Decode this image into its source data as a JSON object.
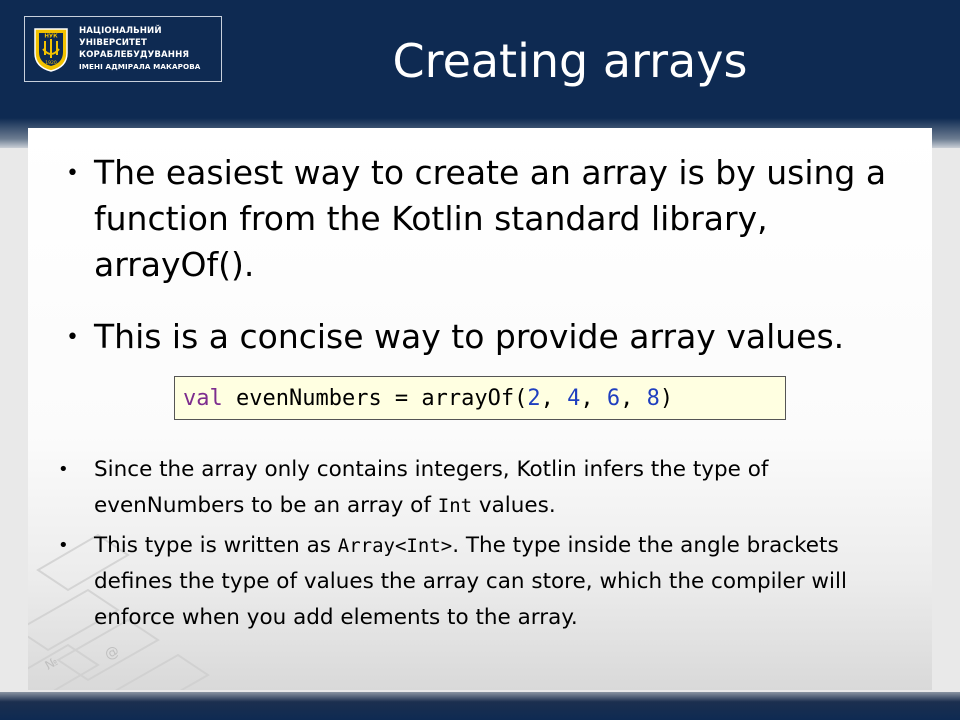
{
  "logo": {
    "lines": [
      "НАЦІОНАЛЬНИЙ",
      "УНІВЕРСИТЕТ",
      "КОРАБЛЕБУДУВАННЯ",
      "ІМЕНІ АДМІРАЛА МАКАРОВА"
    ],
    "emblem_letters": "НУК",
    "emblem_year": "1920"
  },
  "slide": {
    "title": "Creating arrays",
    "bullets": [
      "The easiest way to create an array is by using a function from the Kotlin standard library, arrayOf().",
      "This is a concise way to provide array values."
    ],
    "code": {
      "keyword": "val",
      "rest": " evenNumbers = arrayOf(",
      "n1": "2",
      "sep1": ", ",
      "n2": "4",
      "sep2": ", ",
      "n3": "6",
      "sep3": ", ",
      "n4": "8",
      "close": ")"
    },
    "sub_bullets": [
      {
        "before": "Since the array only contains integers, Kotlin infers the type of evenNumbers to be an array of ",
        "code": "Int",
        "after": " values."
      },
      {
        "before": "This type is written as ",
        "code": "Array<Int>",
        "after": ". The type inside the angle brackets defines the type of values the array can store, which the compiler will enforce when you add elements to the array."
      }
    ]
  },
  "colors": {
    "header": "#0e2a52",
    "code_background": "#ffffe1",
    "keyword": "#7d2d8e",
    "number": "#1f3fbf"
  }
}
